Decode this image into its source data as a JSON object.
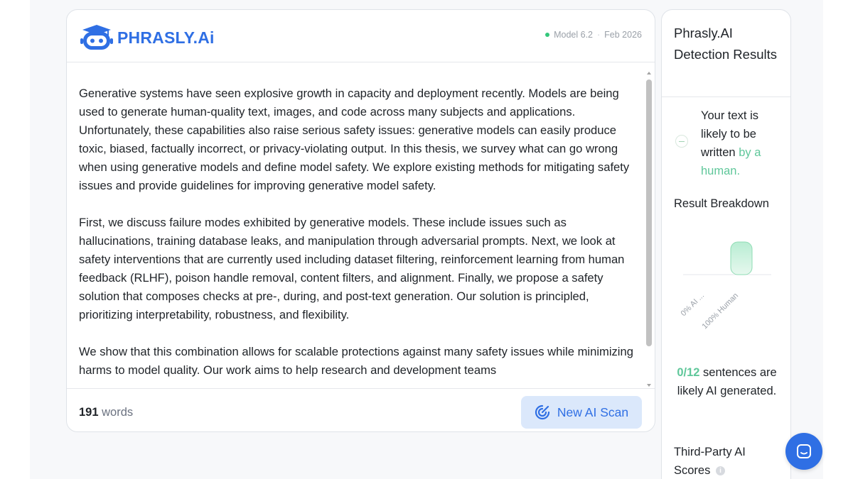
{
  "header": {
    "brand": "PHRASLY.Ai",
    "model": "Model 6.2",
    "date": "Feb 2026",
    "status_color": "#34c77b"
  },
  "editor": {
    "paragraphs": [
      "Generative systems have seen explosive growth in capacity and deployment recently. Models are being used to generate human-quality text, images, and code across many subjects and applications. Unfortunately, these capabilities also raise serious safety issues: generative models can easily produce toxic, biased, factually incorrect, or privacy-violating output. In this thesis, we survey what can go wrong when using generative models and define model safety. We explore existing methods for mitigating safety issues and provide guidelines for improving generative model safety.",
      "First, we discuss failure modes exhibited by generative models. These include issues such as hallucinations, training database leaks, and manipulation through adversarial prompts. Next, we look at safety interventions that are currently used including dataset filtering, reinforcement learning from human feedback (RLHF), poison handle removal, content filters, and alignment. Finally, we propose a safety solution that composes checks at pre-, during, and post-text generation. Our solution is principled, prioritizing interpretability, robustness, and flexibility.",
      "We show that this combination allows for scalable protections against many safety issues while minimizing harms to model quality. Our work aims to help research and development teams"
    ]
  },
  "footer": {
    "word_count": "191",
    "word_label": "words",
    "scan_label": "New AI Scan"
  },
  "results": {
    "title": "Phrasly.AI Detection Results",
    "verdict_prefix": "Your text is likely to be written",
    "verdict_highlight": "by a human.",
    "breakdown_title": "Result Breakdown",
    "sentences_count": "0/12",
    "sentences_text": "sentences are likely AI generated.",
    "third_party_title": "Third-Party AI Scores",
    "info_glyph": "i",
    "accent_color": "#5fc79a"
  },
  "chart_data": {
    "type": "bar",
    "categories": [
      "0% AI ...",
      "100% Human"
    ],
    "values": [
      0,
      100
    ],
    "ylim": [
      0,
      100
    ],
    "grid": false
  }
}
